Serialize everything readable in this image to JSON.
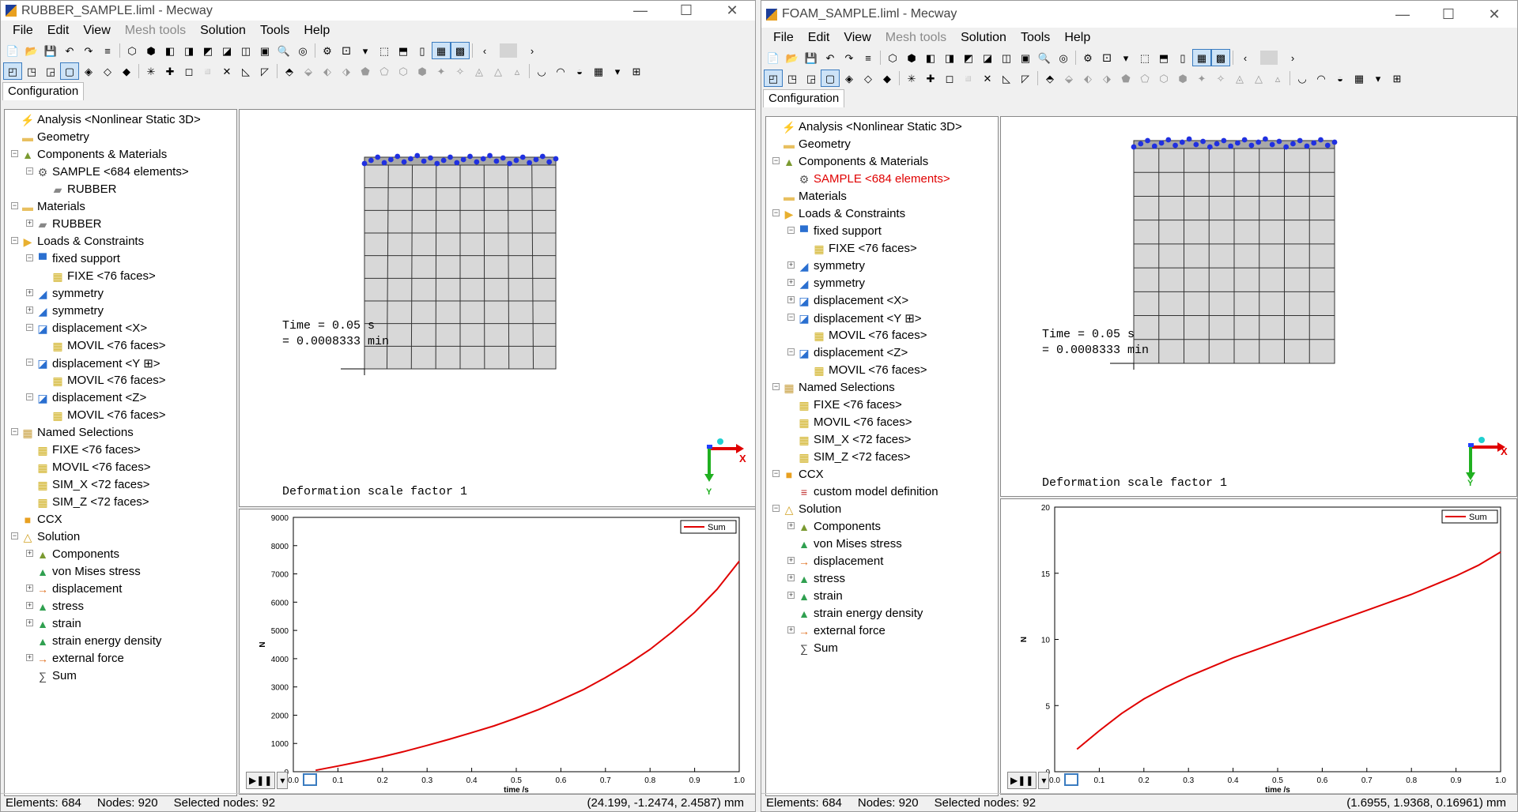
{
  "windows": [
    {
      "title": "RUBBER_SAMPLE.liml - Mecway",
      "menu": [
        "File",
        "Edit",
        "View",
        "Mesh tools",
        "Solution",
        "Tools",
        "Help"
      ],
      "tab": "Configuration",
      "tree": [
        {
          "label": "Analysis <Nonlinear Static 3D>",
          "icon": "lightning-icon",
          "level": 0,
          "exp": ""
        },
        {
          "label": "Geometry",
          "icon": "folder-icon",
          "level": 0,
          "exp": ""
        },
        {
          "label": "Components & Materials",
          "icon": "components-icon",
          "level": 0,
          "exp": "-"
        },
        {
          "label": "SAMPLE <684 elements>",
          "icon": "component-icon",
          "level": 1,
          "exp": "-"
        },
        {
          "label": "RUBBER",
          "icon": "material-icon",
          "level": 2,
          "exp": ""
        },
        {
          "label": "Materials",
          "icon": "folder-icon",
          "level": 0,
          "exp": "-"
        },
        {
          "label": "RUBBER",
          "icon": "material-icon",
          "level": 1,
          "exp": "+"
        },
        {
          "label": "Loads & Constraints",
          "icon": "loads-icon",
          "level": 0,
          "exp": "-"
        },
        {
          "label": "fixed support",
          "icon": "fixed-support-icon",
          "level": 1,
          "exp": "-"
        },
        {
          "label": "FIXE <76 faces>",
          "icon": "faces-icon",
          "level": 2,
          "exp": ""
        },
        {
          "label": "symmetry",
          "icon": "symmetry-icon",
          "level": 1,
          "exp": "+"
        },
        {
          "label": "symmetry",
          "icon": "symmetry-icon",
          "level": 1,
          "exp": "+"
        },
        {
          "label": "displacement <X>",
          "icon": "displacement-icon",
          "level": 1,
          "exp": "-"
        },
        {
          "label": "MOVIL <76 faces>",
          "icon": "faces-icon",
          "level": 2,
          "exp": ""
        },
        {
          "label": "displacement <Y ⊞>",
          "icon": "displacement-icon",
          "level": 1,
          "exp": "-"
        },
        {
          "label": "MOVIL <76 faces>",
          "icon": "faces-icon",
          "level": 2,
          "exp": ""
        },
        {
          "label": "displacement <Z>",
          "icon": "displacement-icon",
          "level": 1,
          "exp": "-"
        },
        {
          "label": "MOVIL <76 faces>",
          "icon": "faces-icon",
          "level": 2,
          "exp": ""
        },
        {
          "label": "Named Selections",
          "icon": "named-selections-icon",
          "level": 0,
          "exp": "-"
        },
        {
          "label": "FIXE <76 faces>",
          "icon": "faces-icon",
          "level": 1,
          "exp": ""
        },
        {
          "label": "MOVIL <76 faces>",
          "icon": "faces-icon",
          "level": 1,
          "exp": ""
        },
        {
          "label": "SIM_X <72 faces>",
          "icon": "faces-icon",
          "level": 1,
          "exp": ""
        },
        {
          "label": "SIM_Z <72 faces>",
          "icon": "faces-icon",
          "level": 1,
          "exp": ""
        },
        {
          "label": "CCX",
          "icon": "ccx-icon",
          "level": 0,
          "exp": ""
        },
        {
          "label": "Solution",
          "icon": "solution-icon",
          "level": 0,
          "exp": "-"
        },
        {
          "label": "Components",
          "icon": "components-icon",
          "level": 1,
          "exp": "+"
        },
        {
          "label": "von Mises stress",
          "icon": "stress-icon",
          "level": 1,
          "exp": ""
        },
        {
          "label": "displacement",
          "icon": "arrow-icon",
          "level": 1,
          "exp": "+"
        },
        {
          "label": "stress",
          "icon": "stress-icon",
          "level": 1,
          "exp": "+"
        },
        {
          "label": "strain",
          "icon": "stress-icon",
          "level": 1,
          "exp": "+"
        },
        {
          "label": "strain energy density",
          "icon": "stress-icon",
          "level": 1,
          "exp": ""
        },
        {
          "label": "external force",
          "icon": "arrow-icon",
          "level": 1,
          "exp": "+"
        },
        {
          "label": "Sum",
          "icon": "sum-icon",
          "level": 1,
          "exp": ""
        }
      ],
      "view_time_line1": "Time = 0.05 s",
      "view_time_line2": "= 0.0008333 min",
      "view_scale": "Deformation scale factor 1",
      "axis_x": "X",
      "axis_y": "Y",
      "status": {
        "elements": "Elements: 684",
        "nodes": "Nodes: 920",
        "selected": "Selected nodes: 92",
        "coord": "(24.199, -1.2474, 2.4587) mm"
      },
      "chart_data": {
        "type": "line",
        "xlabel": "time /s",
        "ylabel": "N",
        "xlim": [
          0,
          1
        ],
        "ylim": [
          0,
          9000
        ],
        "xticks": [
          "0.0",
          "0.1",
          "0.2",
          "0.3",
          "0.4",
          "0.5",
          "0.6",
          "0.7",
          "0.8",
          "0.9",
          "1.0"
        ],
        "yticks": [
          "0",
          "1000",
          "2000",
          "3000",
          "4000",
          "5000",
          "6000",
          "7000",
          "8000",
          "9000"
        ],
        "legend": "top-right",
        "series": [
          {
            "name": "Sum",
            "color": "#e00000",
            "x": [
              0.05,
              0.1,
              0.15,
              0.2,
              0.25,
              0.3,
              0.35,
              0.4,
              0.45,
              0.5,
              0.55,
              0.6,
              0.65,
              0.7,
              0.75,
              0.8,
              0.85,
              0.9,
              0.95,
              1.0
            ],
            "y": [
              50,
              200,
              360,
              530,
              720,
              930,
              1150,
              1380,
              1620,
              1900,
              2200,
              2540,
              2900,
              3330,
              3800,
              4330,
              4950,
              5640,
              6450,
              7450
            ]
          }
        ]
      }
    },
    {
      "title": "FOAM_SAMPLE.liml - Mecway",
      "menu": [
        "File",
        "Edit",
        "View",
        "Mesh tools",
        "Solution",
        "Tools",
        "Help"
      ],
      "tab": "Configuration",
      "tree": [
        {
          "label": "Analysis <Nonlinear Static 3D>",
          "icon": "lightning-icon",
          "level": 0,
          "exp": ""
        },
        {
          "label": "Geometry",
          "icon": "folder-icon",
          "level": 0,
          "exp": ""
        },
        {
          "label": "Components & Materials",
          "icon": "components-icon",
          "level": 0,
          "exp": "-"
        },
        {
          "label": "SAMPLE <684 elements>",
          "icon": "component-icon",
          "level": 1,
          "exp": "",
          "red": true
        },
        {
          "label": "Materials",
          "icon": "folder-icon",
          "level": 0,
          "exp": ""
        },
        {
          "label": "Loads & Constraints",
          "icon": "loads-icon",
          "level": 0,
          "exp": "-"
        },
        {
          "label": "fixed support",
          "icon": "fixed-support-icon",
          "level": 1,
          "exp": "-"
        },
        {
          "label": "FIXE <76 faces>",
          "icon": "faces-icon",
          "level": 2,
          "exp": ""
        },
        {
          "label": "symmetry",
          "icon": "symmetry-icon",
          "level": 1,
          "exp": "+"
        },
        {
          "label": "symmetry",
          "icon": "symmetry-icon",
          "level": 1,
          "exp": "+"
        },
        {
          "label": "displacement <X>",
          "icon": "displacement-icon",
          "level": 1,
          "exp": "+"
        },
        {
          "label": "displacement <Y ⊞>",
          "icon": "displacement-icon",
          "level": 1,
          "exp": "-"
        },
        {
          "label": "MOVIL <76 faces>",
          "icon": "faces-icon",
          "level": 2,
          "exp": ""
        },
        {
          "label": "displacement <Z>",
          "icon": "displacement-icon",
          "level": 1,
          "exp": "-"
        },
        {
          "label": "MOVIL <76 faces>",
          "icon": "faces-icon",
          "level": 2,
          "exp": ""
        },
        {
          "label": "Named Selections",
          "icon": "named-selections-icon",
          "level": 0,
          "exp": "-"
        },
        {
          "label": "FIXE <76 faces>",
          "icon": "faces-icon",
          "level": 1,
          "exp": ""
        },
        {
          "label": "MOVIL <76 faces>",
          "icon": "faces-icon",
          "level": 1,
          "exp": ""
        },
        {
          "label": "SIM_X <72 faces>",
          "icon": "faces-icon",
          "level": 1,
          "exp": ""
        },
        {
          "label": "SIM_Z <72 faces>",
          "icon": "faces-icon",
          "level": 1,
          "exp": ""
        },
        {
          "label": "CCX",
          "icon": "ccx-icon",
          "level": 0,
          "exp": "-"
        },
        {
          "label": "custom model definition",
          "icon": "ccx-def-icon",
          "level": 1,
          "exp": ""
        },
        {
          "label": "Solution",
          "icon": "solution-icon",
          "level": 0,
          "exp": "-"
        },
        {
          "label": "Components",
          "icon": "components-icon",
          "level": 1,
          "exp": "+"
        },
        {
          "label": "von Mises stress",
          "icon": "stress-icon",
          "level": 1,
          "exp": ""
        },
        {
          "label": "displacement",
          "icon": "arrow-icon",
          "level": 1,
          "exp": "+"
        },
        {
          "label": "stress",
          "icon": "stress-icon",
          "level": 1,
          "exp": "+"
        },
        {
          "label": "strain",
          "icon": "stress-icon",
          "level": 1,
          "exp": "+"
        },
        {
          "label": "strain energy density",
          "icon": "stress-icon",
          "level": 1,
          "exp": ""
        },
        {
          "label": "external force",
          "icon": "arrow-icon",
          "level": 1,
          "exp": "+"
        },
        {
          "label": "Sum",
          "icon": "sum-icon",
          "level": 1,
          "exp": ""
        }
      ],
      "view_time_line1": "Time = 0.05 s",
      "view_time_line2": "= 0.0008333 min",
      "view_scale": "Deformation scale factor 1",
      "axis_x": "X",
      "axis_y": "Y",
      "status": {
        "elements": "Elements: 684",
        "nodes": "Nodes: 920",
        "selected": "Selected nodes: 92",
        "coord": "(1.6955, 1.9368, 0.16961) mm"
      },
      "chart_data": {
        "type": "line",
        "xlabel": "time /s",
        "ylabel": "N",
        "xlim": [
          0,
          1
        ],
        "ylim": [
          0,
          20
        ],
        "xticks": [
          "0.0",
          "0.1",
          "0.2",
          "0.3",
          "0.4",
          "0.5",
          "0.6",
          "0.7",
          "0.8",
          "0.9",
          "1.0"
        ],
        "yticks": [
          "0",
          "5",
          "10",
          "15",
          "20"
        ],
        "legend": "top-right",
        "series": [
          {
            "name": "Sum",
            "color": "#e00000",
            "x": [
              0.05,
              0.1,
              0.15,
              0.2,
              0.25,
              0.3,
              0.35,
              0.4,
              0.45,
              0.5,
              0.55,
              0.6,
              0.65,
              0.7,
              0.75,
              0.8,
              0.85,
              0.9,
              0.95,
              1.0
            ],
            "y": [
              1.7,
              3.1,
              4.4,
              5.5,
              6.4,
              7.2,
              7.9,
              8.6,
              9.2,
              9.8,
              10.4,
              11.0,
              11.6,
              12.2,
              12.8,
              13.4,
              14.1,
              14.8,
              15.6,
              16.6
            ]
          }
        ]
      }
    }
  ]
}
